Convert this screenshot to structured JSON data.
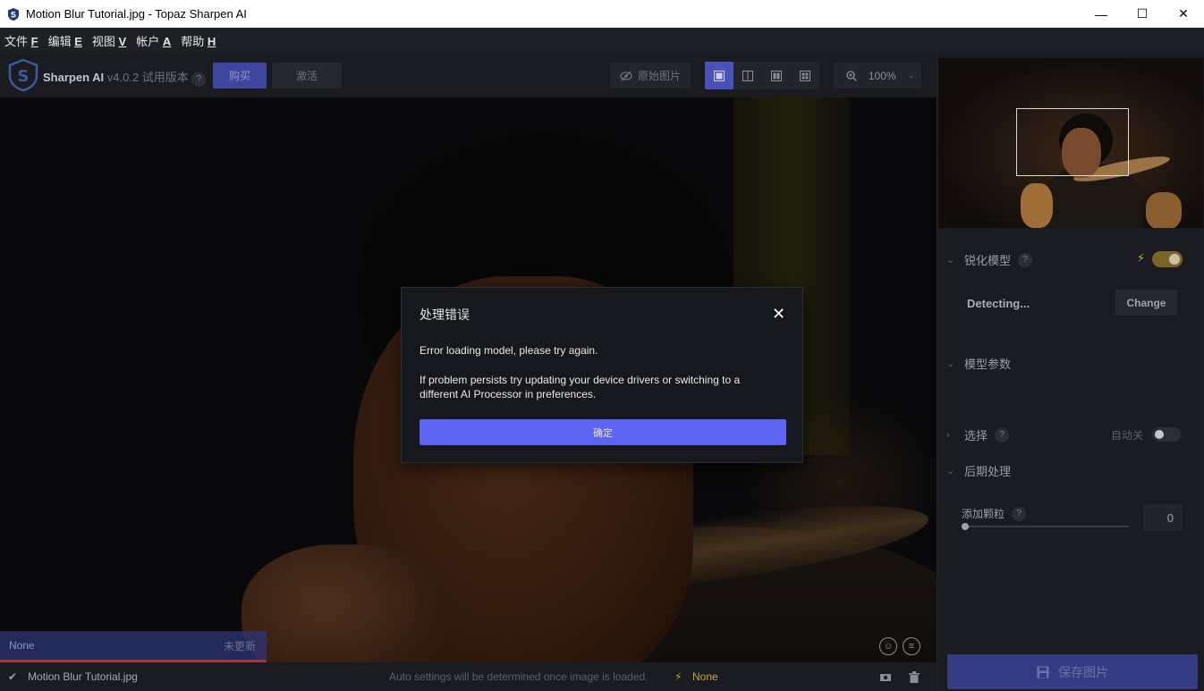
{
  "window": {
    "title": "Motion Blur Tutorial.jpg - Topaz Sharpen AI",
    "minimize": "—",
    "maximize": "☐",
    "close": "✕"
  },
  "menu": [
    {
      "label": "文件",
      "key": "F"
    },
    {
      "label": "编辑",
      "key": "E"
    },
    {
      "label": "视图",
      "key": "V"
    },
    {
      "label": "帐户",
      "key": "A"
    },
    {
      "label": "帮助",
      "key": "H"
    }
  ],
  "toolbar": {
    "brand": "Sharpen AI",
    "version": "v4.0.2 试用版本",
    "help": "?",
    "buy": "购买",
    "activate": "激活",
    "original": "原始图片",
    "zoom": "100%"
  },
  "canvas": {
    "strip_left": "None",
    "strip_right": "未更新"
  },
  "statusbar": {
    "check": "✔",
    "filename": "Motion Blur Tutorial.jpg",
    "auto_text": "Auto settings will be determined once image is loaded.",
    "model": "None"
  },
  "panel": {
    "sharpen_model": "锐化模型",
    "detecting": "Detecting...",
    "change": "Change",
    "model_params": "模型参数",
    "selection": "选择",
    "auto_off": "自动关",
    "post_processing": "后期处理",
    "add_grain": "添加颗粒",
    "grain_value": "0",
    "save": "保存图片",
    "help": "?"
  },
  "dialog": {
    "title": "处理错误",
    "close": "✕",
    "message1": "Error loading model, please try again.",
    "message2": "If problem persists try updating your device drivers or switching to a different AI Processor in preferences.",
    "ok": "确定"
  },
  "colors": {
    "accent": "#5d64f2",
    "buy": "#3f46a0",
    "warning": "#c9a53a",
    "bg": "#1b1c22"
  }
}
